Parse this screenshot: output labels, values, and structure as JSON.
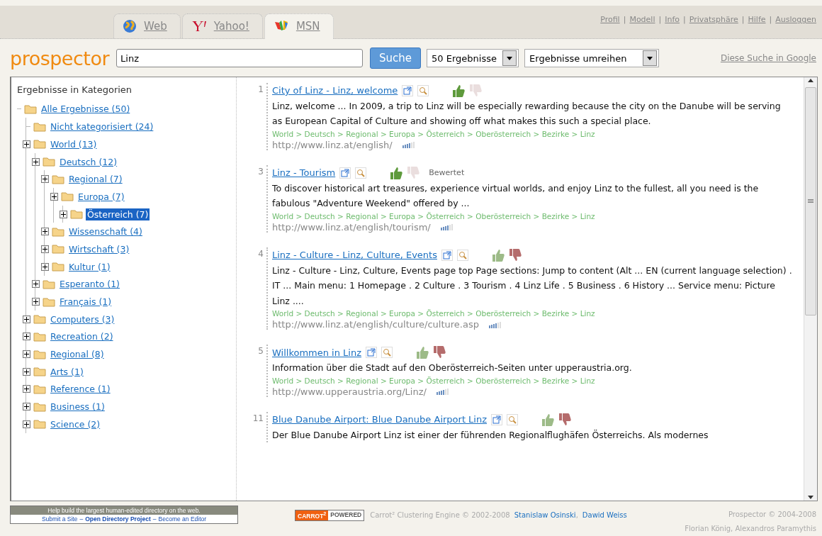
{
  "tabs": [
    {
      "label": "Web",
      "kind": "globe",
      "selected": false
    },
    {
      "label": "Yahoo!",
      "kind": "yahoo",
      "selected": false
    },
    {
      "label": "MSN",
      "kind": "msn",
      "selected": true
    }
  ],
  "top_links": [
    "Profil",
    "Modell",
    "Info",
    "Privatsphäre",
    "Hilfe",
    "Ausloggen"
  ],
  "top_links_separator": "|",
  "logo": "prospector",
  "search": {
    "value": "Linz",
    "button": "Suche"
  },
  "selects": [
    "50 Ergebnisse",
    "Ergebnisse umreihen"
  ],
  "google_link": "Diese Suche in Google",
  "sidebar": {
    "title": "Ergebnisse in Kategorien",
    "tree": [
      {
        "label": "Alle Ergebnisse (50)",
        "toggle": false,
        "selected": false,
        "children": [
          {
            "label": "Nicht kategorisiert (24)",
            "toggle": false,
            "selected": false
          },
          {
            "label": "World (13)",
            "toggle": true,
            "selected": false,
            "children": [
              {
                "label": "Deutsch (12)",
                "toggle": true,
                "selected": false,
                "children": [
                  {
                    "label": "Regional (7)",
                    "toggle": true,
                    "selected": false,
                    "children": [
                      {
                        "label": "Europa (7)",
                        "toggle": true,
                        "selected": false,
                        "children": [
                          {
                            "label": "Österreich (7)",
                            "toggle": true,
                            "selected": true
                          }
                        ]
                      }
                    ]
                  },
                  {
                    "label": "Wissenschaft (4)",
                    "toggle": true,
                    "selected": false
                  },
                  {
                    "label": "Wirtschaft (3)",
                    "toggle": true,
                    "selected": false
                  },
                  {
                    "label": "Kultur (1)",
                    "toggle": true,
                    "selected": false
                  }
                ]
              },
              {
                "label": "Esperanto (1)",
                "toggle": true,
                "selected": false
              },
              {
                "label": "Français (1)",
                "toggle": true,
                "selected": false
              }
            ]
          },
          {
            "label": "Computers (3)",
            "toggle": true,
            "selected": false
          },
          {
            "label": "Recreation (2)",
            "toggle": true,
            "selected": false
          },
          {
            "label": "Regional (8)",
            "toggle": true,
            "selected": false
          },
          {
            "label": "Arts (1)",
            "toggle": true,
            "selected": false
          },
          {
            "label": "Reference (1)",
            "toggle": true,
            "selected": false
          },
          {
            "label": "Business (1)",
            "toggle": true,
            "selected": false
          },
          {
            "label": "Science (2)",
            "toggle": true,
            "selected": false
          }
        ]
      }
    ]
  },
  "results": [
    {
      "rank": "1",
      "title": "City of Linz - Linz, welcome",
      "rated_up": true,
      "snippet": "Linz, welcome ... In 2009, a trip to Linz will be especially rewarding because the city on the Danube will be serving as European Capital of Culture and showing off what makes this such a special place.",
      "path": "World > Deutsch > Regional > Europa > Österreich > Oberösterreich > Bezirke > Linz",
      "url": "http://www.linz.at/english/",
      "level": 0.67
    },
    {
      "rank": "3",
      "title": "Linz - Tourism",
      "rated_up": true,
      "status": "Bewertet",
      "snippet": "To discover historical art treasures, experience virtual worlds, and enjoy Linz to the fullest, all you need is the fabulous \"Adventure Weekend\" offered by ...",
      "path": "World > Deutsch > Regional > Europa > Österreich > Oberösterreich > Bezirke > Linz",
      "url": "http://www.linz.at/english/tourism/",
      "level": 0.67
    },
    {
      "rank": "4",
      "title": "Linz - Culture - Linz, Culture, Events",
      "rated_up": false,
      "snippet": "Linz - Culture - Linz, Culture, Events page top Page sections: Jump to content (Alt ... EN (current language selection) . IT ... Main menu: 1 Homepage . 2 Culture . 3 Tourism . 4 Linz Life . 5 Business . 6 History ... Service menu: Picture Linz ....",
      "path": "World > Deutsch > Regional > Europa > Österreich > Oberösterreich > Bezirke > Linz",
      "url": "http://www.linz.at/english/culture/culture.asp",
      "level": 0.67
    },
    {
      "rank": "5",
      "title": "Willkommen in Linz",
      "rated_up": false,
      "snippet": "Information über die Stadt auf den Oberösterreich-Seiten unter upperaustria.org.",
      "path": "World > Deutsch > Regional > Europa > Österreich > Oberösterreich > Bezirke > Linz",
      "url": "http://www.upperaustria.org/Linz/",
      "level": 0.67
    },
    {
      "rank": "11",
      "title": "Blue Danube Airport: Blue Danube Airport Linz",
      "rated_up": false,
      "snippet": "Der Blue Danube Airport Linz ist einer der führenden Regionalflughäfen Österreichs. Als modernes"
    }
  ],
  "footer": {
    "odp_text": "Help build the largest human-edited directory on the web.",
    "odp_links": [
      "Submit a Site",
      "Open Directory Project",
      "Become an Editor"
    ],
    "odp_separator": "–",
    "badge": [
      "CARROT$^{2}$",
      "POWERED"
    ],
    "engine": "Carrot² Clustering Engine © 2002-2008",
    "authors": [
      "Stanislaw Osinski",
      "Dawid Weiss"
    ],
    "authors_separator": ",",
    "credits": [
      "Prospector © 2004-2008",
      "Florian König, Alexandros Paramythis"
    ]
  }
}
